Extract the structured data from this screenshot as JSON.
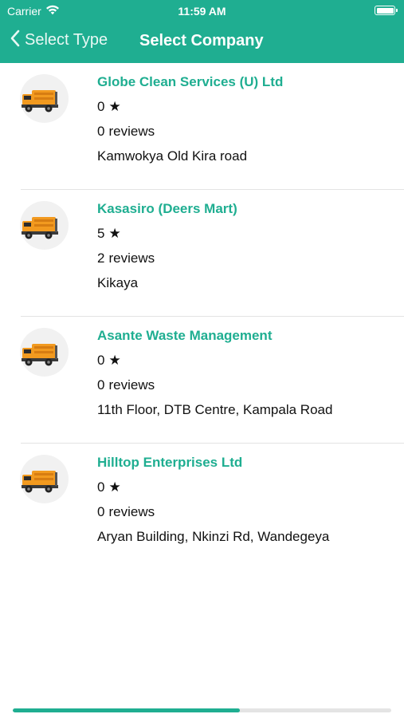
{
  "status_bar": {
    "carrier": "Carrier",
    "time": "11:59 AM",
    "wifi_icon": "wifi-icon",
    "battery_icon": "battery-icon"
  },
  "nav": {
    "back_label": "Select Type",
    "back_icon": "chevron-left-icon",
    "title": "Select Company"
  },
  "companies": [
    {
      "name": "Globe Clean Services (U) Ltd",
      "rating": "0",
      "review_count": "0",
      "review_word": "reviews",
      "address": "Kamwokya Old Kira road",
      "icon": "garbage-truck-icon"
    },
    {
      "name": "Kasasiro (Deers Mart)",
      "rating": "5",
      "review_count": "2",
      "review_word": "reviews",
      "address": "Kikaya",
      "icon": "garbage-truck-icon"
    },
    {
      "name": "Asante Waste Management",
      "rating": "0",
      "review_count": "0",
      "review_word": "reviews",
      "address": "11th Floor, DTB Centre, Kampala Road",
      "icon": "garbage-truck-icon"
    },
    {
      "name": "Hilltop Enterprises Ltd",
      "rating": "0",
      "review_count": "0",
      "review_word": "reviews",
      "address": "Aryan Building, Nkinzi Rd, Wandegeya",
      "icon": "garbage-truck-icon"
    }
  ],
  "star_glyph": "★",
  "scroll_progress": 0.6,
  "colors": {
    "brand": "#1fae91",
    "text": "#111111",
    "divider": "#e3e3e3",
    "truck_body": "#f29a1f"
  }
}
